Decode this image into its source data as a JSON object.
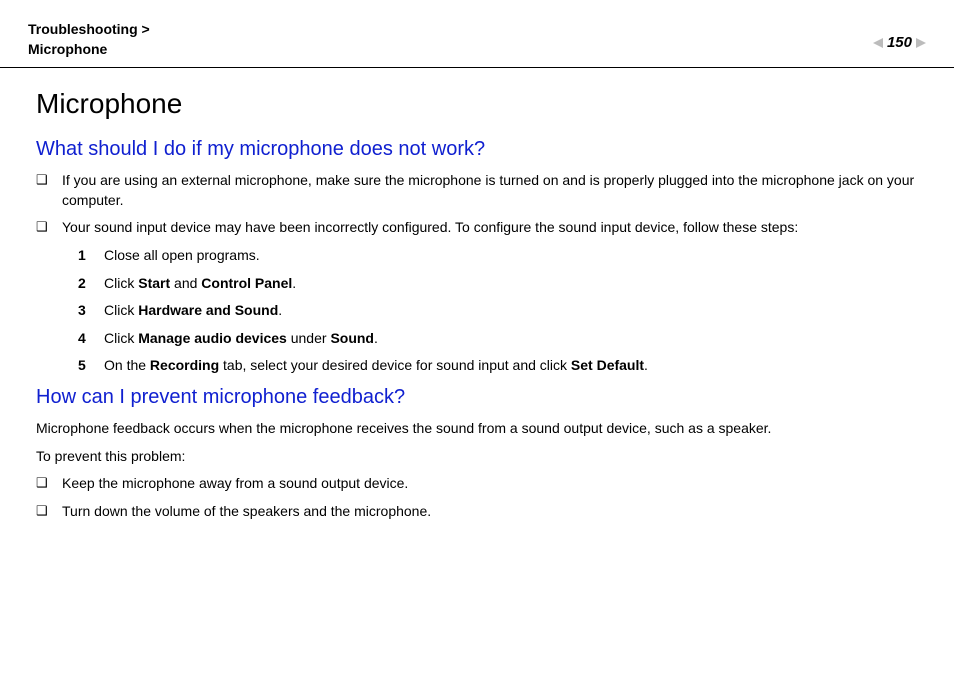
{
  "header": {
    "breadcrumb_parent": "Troubleshooting",
    "breadcrumb_sep": " > ",
    "breadcrumb_current": "Microphone",
    "page_number": "150"
  },
  "title": "Microphone",
  "section1": {
    "heading": "What should I do if my microphone does not work?",
    "bullets": [
      "If you are using an external microphone, make sure the microphone is turned on and is properly plugged into the microphone jack on your computer.",
      "Your sound input device may have been incorrectly configured. To configure the sound input device, follow these steps:"
    ],
    "steps": [
      {
        "n": "1",
        "html": "Close all open programs."
      },
      {
        "n": "2",
        "html": "Click <b>Start</b> and <b>Control Panel</b>."
      },
      {
        "n": "3",
        "html": "Click <b>Hardware and Sound</b>."
      },
      {
        "n": "4",
        "html": "Click <b>Manage audio devices</b> under <b>Sound</b>."
      },
      {
        "n": "5",
        "html": "On the <b>Recording</b> tab, select your desired device for sound input and click <b>Set Default</b>."
      }
    ]
  },
  "section2": {
    "heading": "How can I prevent microphone feedback?",
    "intro": "Microphone feedback occurs when the microphone receives the sound from a sound output device, such as a speaker.",
    "intro2": "To prevent this problem:",
    "bullets": [
      "Keep the microphone away from a sound output device.",
      "Turn down the volume of the speakers and the microphone."
    ]
  }
}
